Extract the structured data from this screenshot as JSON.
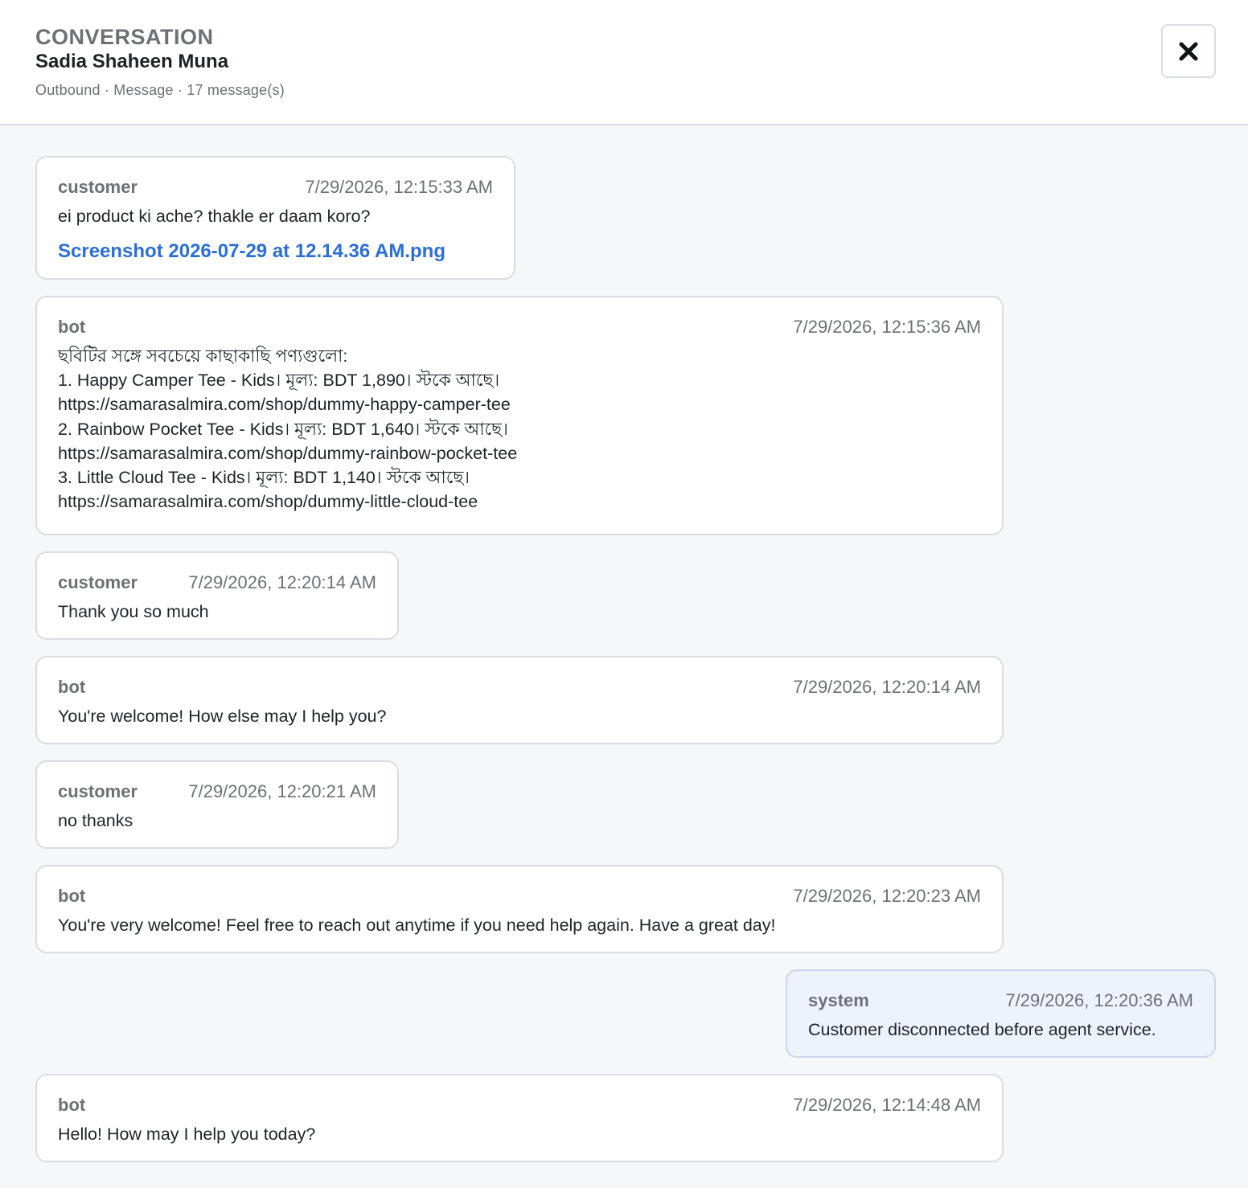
{
  "header": {
    "eyebrow": "CONVERSATION",
    "contact_name": "Sadia Shaheen Muna",
    "meta": "Outbound · Message · 17 message(s)",
    "close_icon": "close-icon"
  },
  "messages": [
    {
      "role": "customer",
      "time": "7/29/2026, 12:15:33 AM",
      "text": "ei product ki ache? thakle er daam koro?",
      "attachment": "Screenshot 2026-07-29 at 12.14.36 AM.png"
    },
    {
      "role": "bot",
      "time": "7/29/2026, 12:15:36 AM",
      "text": "ছবিটির সঙ্গে সবচেয়ে কাছাকাছি পণ্যগুলো:\n1. Happy Camper Tee - Kids। মূল্য: BDT 1,890। স্টকে আছে।\nhttps://samarasalmira.com/shop/dummy-happy-camper-tee\n2. Rainbow Pocket Tee - Kids। মূল্য: BDT 1,640। স্টকে আছে।\nhttps://samarasalmira.com/shop/dummy-rainbow-pocket-tee\n3. Little Cloud Tee - Kids। মূল্য: BDT 1,140। স্টকে আছে।\nhttps://samarasalmira.com/shop/dummy-little-cloud-tee"
    },
    {
      "role": "customer",
      "time": "7/29/2026, 12:20:14 AM",
      "text": "Thank you so much"
    },
    {
      "role": "bot",
      "time": "7/29/2026, 12:20:14 AM",
      "text": "You're welcome! How else may I help you?"
    },
    {
      "role": "customer",
      "time": "7/29/2026, 12:20:21 AM",
      "text": "no thanks"
    },
    {
      "role": "bot",
      "time": "7/29/2026, 12:20:23 AM",
      "text": "You're very welcome! Feel free to reach out anytime if you need help again. Have a great day!"
    },
    {
      "role": "system",
      "time": "7/29/2026, 12:20:36 AM",
      "text": "Customer disconnected before agent service."
    },
    {
      "role": "bot",
      "time": "7/29/2026, 12:14:48 AM",
      "text": "Hello! How may I help you today?"
    }
  ],
  "colors": {
    "page_background": "#f6f7f9",
    "bubble_background": "#ffffff",
    "system_bubble_background": "#eef3fb",
    "border": "#d9dce1",
    "muted_text": "#6e7076",
    "attachment_link": "#2b6fd6"
  }
}
